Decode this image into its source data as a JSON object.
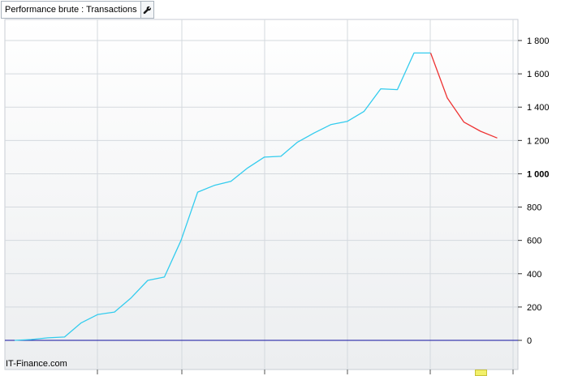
{
  "header": {
    "title": "Performance brute : Transactions",
    "settings_icon": "wrench-icon"
  },
  "footer": {
    "source": "IT-Finance.com"
  },
  "colors": {
    "rising_line": "#33ccee",
    "falling_line": "#ee3333",
    "zero_line": "#1010a0",
    "grid": "#d4d9de",
    "background_top": "#ffffff",
    "background_bottom": "#eef0f1",
    "marker": "#f2f06a"
  },
  "chart_data": {
    "type": "line",
    "title": "Performance brute : Transactions",
    "xlabel": "",
    "ylabel": "",
    "ylim": [
      -60,
      1850
    ],
    "grid": true,
    "y_axis_side": "right",
    "y_ticks": [
      {
        "value": 0,
        "label": "0"
      },
      {
        "value": 200,
        "label": "200"
      },
      {
        "value": 400,
        "label": "400"
      },
      {
        "value": 600,
        "label": "600"
      },
      {
        "value": 800,
        "label": "800"
      },
      {
        "value": 1000,
        "label": "1 000",
        "bold": true
      },
      {
        "value": 1200,
        "label": "1 200"
      },
      {
        "value": 1400,
        "label": "1 400"
      },
      {
        "value": 1600,
        "label": "1 600"
      },
      {
        "value": 1800,
        "label": "1 800"
      }
    ],
    "x": [
      0,
      1,
      2,
      3,
      4,
      5,
      6,
      7,
      8,
      9,
      10,
      11,
      12,
      13,
      14,
      15,
      16,
      17,
      18,
      19,
      20,
      21,
      22,
      23,
      24,
      25,
      26,
      27,
      28,
      29
    ],
    "series": [
      {
        "color": "#33ccee",
        "x": [
          0,
          1,
          2,
          3,
          4,
          5,
          6,
          7,
          8,
          9,
          10,
          11,
          12,
          13,
          14,
          15,
          16,
          17,
          18,
          19,
          20,
          21,
          22,
          23,
          24,
          25
        ],
        "values": [
          0,
          5,
          15,
          20,
          105,
          155,
          170,
          255,
          360,
          380,
          600,
          890,
          930,
          955,
          1035,
          1100,
          1105,
          1190,
          1245,
          1295,
          1315,
          1375,
          1510,
          1505,
          1725,
          1725
        ]
      },
      {
        "color": "#ee3333",
        "x": [
          25,
          26,
          27,
          28,
          29
        ],
        "values": [
          1725,
          1455,
          1310,
          1255,
          1215
        ]
      }
    ],
    "reference_line": {
      "value": 0,
      "color": "#1010a0"
    }
  }
}
